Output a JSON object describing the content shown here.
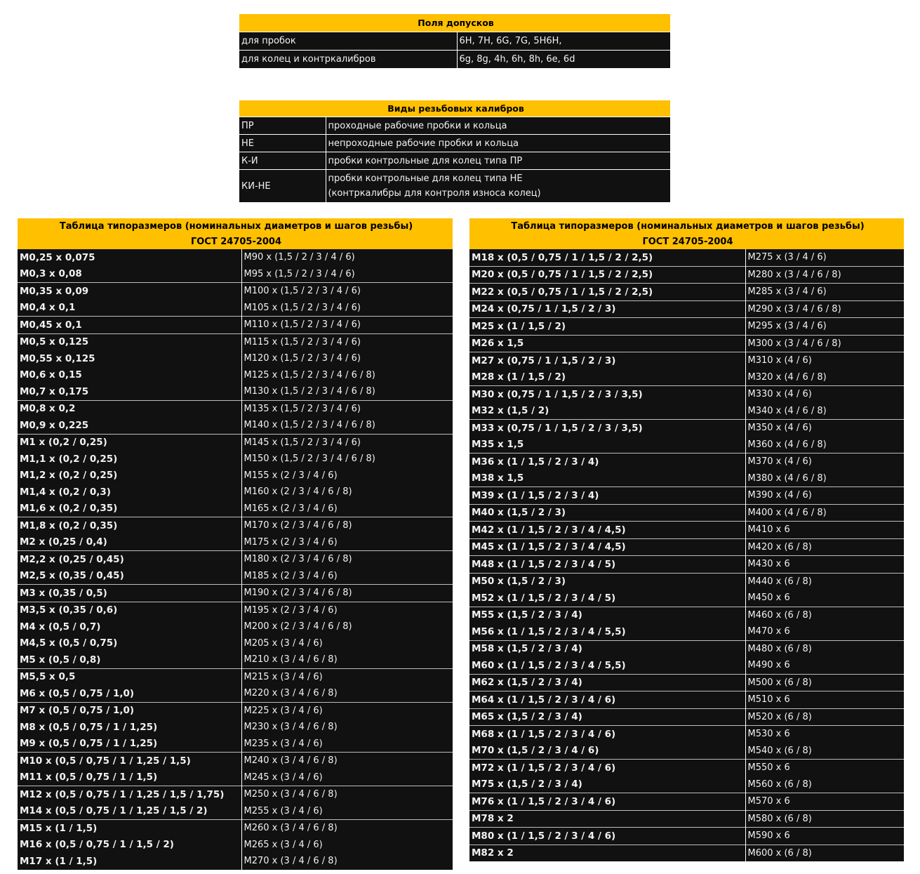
{
  "tolerances": {
    "title": "Поля допусков",
    "rows": [
      {
        "label": "для пробок",
        "value": "6H, 7H, 6G, 7G, 5H6H,"
      },
      {
        "label": "для колец и контркалибров",
        "value": "6g, 8g, 4h, 6h, 8h, 6e, 6d"
      }
    ]
  },
  "gauge_types": {
    "title": "Виды резьбовых калибров",
    "rows": [
      {
        "code": "ПР",
        "desc": "проходные рабочие пробки и кольца"
      },
      {
        "code": "НЕ",
        "desc": "непроходные рабочие пробки и кольца"
      },
      {
        "code": "К-И",
        "desc": "пробки контрольные для колец типа ПР"
      },
      {
        "code": "КИ-НЕ",
        "desc": "пробки контрольные для колец типа НЕ",
        "desc2": "(контркалибры для контроля износа колец)"
      }
    ]
  },
  "size_table_left": {
    "title": "Таблица типоразмеров (номинальных диаметров и шагов резьбы)",
    "subtitle": "ГОСТ 24705-2004",
    "rows": [
      [
        "М0,25 х 0,075",
        "М90 х (1,5 / 2 / 3 / 4 / 6)"
      ],
      [
        "М0,3 х 0,08",
        "М95 х (1,5 / 2 / 3 / 4 / 6)"
      ],
      [
        "М0,35 х 0,09",
        "М100 х (1,5 / 2 / 3 / 4 / 6)"
      ],
      [
        "М0,4 х 0,1",
        "М105 х (1,5 / 2 / 3 / 4 / 6)"
      ],
      [
        "М0,45 х 0,1",
        "М110 х (1,5 / 2 / 3 / 4 / 6)"
      ],
      [
        "М0,5 х 0,125",
        "М115 х (1,5 / 2 / 3 / 4 / 6)"
      ],
      [
        "М0,55 х 0,125",
        "М120 х (1,5 / 2 / 3 / 4 / 6)"
      ],
      [
        "М0,6 х 0,15",
        "М125 х (1,5 / 2 / 3 / 4 / 6 / 8)"
      ],
      [
        "М0,7 х 0,175",
        "М130 х (1,5 / 2 / 3 / 4 / 6 / 8)"
      ],
      [
        "М0,8 х 0,2",
        "М135 х (1,5 / 2 / 3 / 4 / 6)"
      ],
      [
        "М0,9 х 0,225",
        "М140 х (1,5 / 2 / 3 / 4 / 6 / 8)"
      ],
      [
        "М1 х (0,2 / 0,25)",
        "М145 х (1,5 / 2 / 3 / 4 / 6)"
      ],
      [
        "М1,1 х (0,2 / 0,25)",
        "М150 х (1,5 / 2 / 3 / 4 / 6 / 8)"
      ],
      [
        "М1,2 х (0,2 / 0,25)",
        "М155 х (2 / 3 / 4 / 6)"
      ],
      [
        "М1,4 х (0,2 / 0,3)",
        "М160 х (2 / 3 / 4 / 6 / 8)"
      ],
      [
        "М1,6 х (0,2 / 0,35)",
        "М165 х (2 / 3 / 4 / 6)"
      ],
      [
        "М1,8 х (0,2 / 0,35)",
        "М170 х (2 / 3 / 4 / 6 / 8)"
      ],
      [
        "М2 х (0,25 / 0,4)",
        "М175 х (2 / 3 / 4 / 6)"
      ],
      [
        "М2,2 х (0,25 / 0,45)",
        "М180 х (2 / 3 / 4 / 6 / 8)"
      ],
      [
        "М2,5 х (0,35 / 0,45)",
        "М185 х (2 / 3 / 4 / 6)"
      ],
      [
        "М3 х (0,35 / 0,5)",
        "М190 х (2 / 3 / 4 / 6 / 8)"
      ],
      [
        "М3,5 х (0,35 / 0,6)",
        "М195 х (2 / 3 / 4 / 6)"
      ],
      [
        "М4 х (0,5 / 0,7)",
        "М200 х (2 / 3 / 4 / 6 / 8)"
      ],
      [
        "М4,5 х (0,5 / 0,75)",
        "М205 х (3 / 4 / 6)"
      ],
      [
        "М5 х (0,5 / 0,8)",
        "М210 х (3 / 4 / 6 / 8)"
      ],
      [
        "М5,5 х 0,5",
        "М215 х (3 / 4 / 6)"
      ],
      [
        "М6 х (0,5 / 0,75 / 1,0)",
        "М220 х (3 / 4 / 6 / 8)"
      ],
      [
        "М7 х (0,5 / 0,75 / 1,0)",
        "М225 х (3 / 4 / 6)"
      ],
      [
        "М8 х (0,5 / 0,75 / 1 / 1,25)",
        "М230 х (3 / 4 / 6 / 8)"
      ],
      [
        "М9 х (0,5 / 0,75 / 1 / 1,25)",
        "М235 х (3 / 4 / 6)"
      ],
      [
        "М10 х (0,5 / 0,75 / 1 / 1,25 / 1,5)",
        "М240 х (3 / 4 / 6 / 8)"
      ],
      [
        "М11 х (0,5 / 0,75 / 1 / 1,5)",
        "М245 х (3 / 4 / 6)"
      ],
      [
        "М12 х (0,5 / 0,75 / 1 / 1,25 / 1,5 / 1,75)",
        "М250 х (3 / 4 / 6 / 8)"
      ],
      [
        "М14 х (0,5 / 0,75 / 1 / 1,25 / 1,5 / 2)",
        "М255 х (3 / 4 / 6)"
      ],
      [
        "М15 х (1 / 1,5)",
        "М260 х (3 / 4 / 6 / 8)"
      ],
      [
        "М16 х (0,5 / 0,75 / 1 / 1,5 / 2)",
        "М265 х (3 / 4 / 6)"
      ],
      [
        "М17 х (1 / 1,5)",
        "М270 х (3 / 4 / 6 / 8)"
      ]
    ]
  },
  "size_table_right": {
    "title": "Таблица типоразмеров (номинальных диаметров и шагов резьбы)",
    "subtitle": "ГОСТ 24705-2004",
    "rows": [
      [
        "М18 х (0,5 / 0,75 / 1 / 1,5 / 2 / 2,5)",
        "М275 х (3 / 4 / 6)"
      ],
      [
        "М20 х (0,5 / 0,75 / 1 / 1,5 / 2 / 2,5)",
        "М280 х (3 / 4 / 6 / 8)"
      ],
      [
        "М22 х (0,5 / 0,75 / 1 / 1,5 / 2 / 2,5)",
        "М285 х (3 / 4 / 6)"
      ],
      [
        "М24 х (0,75 / 1 / 1,5 / 2 / 3)",
        "М290 х (3 / 4 / 6 / 8)"
      ],
      [
        "М25 х (1 / 1,5 / 2)",
        "М295 х (3 / 4 / 6)"
      ],
      [
        "М26 х 1,5",
        "М300 х (3 / 4 / 6 / 8)"
      ],
      [
        "М27 х (0,75 / 1 / 1,5 / 2 / 3)",
        "М310 х (4 / 6)"
      ],
      [
        "М28 х (1 / 1,5 / 2)",
        "М320 х (4 / 6 / 8)"
      ],
      [
        "М30 х (0,75 / 1 / 1,5 / 2 / 3 / 3,5)",
        "М330 х (4 / 6)"
      ],
      [
        "М32 х (1,5 / 2)",
        "М340 х (4 / 6 / 8)"
      ],
      [
        "М33 х (0,75 / 1 / 1,5 / 2 / 3 / 3,5)",
        "М350 х (4 / 6)"
      ],
      [
        "М35 х 1,5",
        "М360 х (4 / 6 / 8)"
      ],
      [
        "М36 х (1 / 1,5 / 2 / 3 / 4)",
        "М370 х (4 / 6)"
      ],
      [
        "М38 х 1,5",
        "М380 х (4 / 6 / 8)"
      ],
      [
        "М39 х (1 / 1,5 / 2 / 3 / 4)",
        "М390 х (4 / 6)"
      ],
      [
        "М40 х (1,5 / 2 / 3)",
        "М400 х (4 / 6 / 8)"
      ],
      [
        "М42 х (1 / 1,5 / 2 / 3 / 4 / 4,5)",
        "М410 х 6"
      ],
      [
        "М45 х (1 / 1,5 / 2 / 3 / 4 / 4,5)",
        "М420 х (6 / 8)"
      ],
      [
        "М48 х (1 / 1,5 / 2 / 3 / 4 / 5)",
        "М430 х 6"
      ],
      [
        "М50 х (1,5 / 2 / 3)",
        "М440 х (6 / 8)"
      ],
      [
        "М52 х (1 / 1,5 / 2 / 3 / 4 / 5)",
        "М450 х 6"
      ],
      [
        "М55 х (1,5 / 2 / 3 / 4)",
        "М460 х (6 / 8)"
      ],
      [
        "М56 х (1 / 1,5 / 2 / 3 / 4 / 5,5)",
        "М470 х 6"
      ],
      [
        "М58 х (1,5 / 2 / 3 / 4)",
        "М480 х (6 / 8)"
      ],
      [
        "М60 х (1 / 1,5 / 2 / 3 / 4 / 5,5)",
        "М490 х 6"
      ],
      [
        "М62 х (1,5 / 2 / 3 / 4)",
        "М500 х (6 / 8)"
      ],
      [
        "М64 х (1 / 1,5 / 2 / 3 / 4 / 6)",
        "М510 х 6"
      ],
      [
        "М65 х (1,5 / 2 / 3 / 4)",
        "М520 х (6 / 8)"
      ],
      [
        "М68 х (1 / 1,5 / 2 / 3 / 4 / 6)",
        "М530 х 6"
      ],
      [
        "М70 х (1,5 / 2 / 3 / 4 / 6)",
        "М540 х (6 / 8)"
      ],
      [
        "М72 х (1 / 1,5 / 2 / 3 / 4 / 6)",
        "М550 х 6"
      ],
      [
        "М75 х (1,5 / 2 / 3 / 4)",
        "М560 х (6 / 8)"
      ],
      [
        "М76 х (1 / 1,5 / 2 / 3 / 4 / 6)",
        "М570 х 6"
      ],
      [
        "М78 х 2",
        "М580 х (6 / 8)"
      ],
      [
        "М80 х (1 / 1,5 / 2 / 3 / 4 / 6)",
        "М590 х 6"
      ],
      [
        "М82 х 2",
        "М600 х (6 / 8)"
      ]
    ]
  }
}
